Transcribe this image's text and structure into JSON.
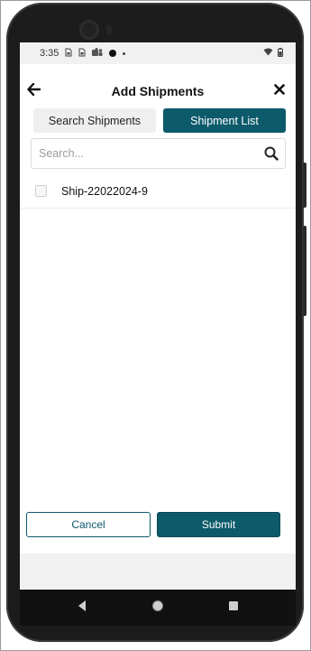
{
  "status_bar": {
    "time": "3:35",
    "icons_left": [
      "sim-icon",
      "sim-icon",
      "teams-icon",
      "notification-dot",
      "more-dot"
    ],
    "icons_right": [
      "wifi-icon",
      "battery-icon"
    ]
  },
  "header": {
    "title": "Add Shipments",
    "back_icon": "back-arrow-icon",
    "close_icon": "close-icon"
  },
  "tabs": [
    {
      "label": "Search Shipments",
      "active": false
    },
    {
      "label": "Shipment List",
      "active": true
    }
  ],
  "search": {
    "placeholder": "Search...",
    "value": ""
  },
  "shipments": [
    {
      "label": "Ship-22022024-9",
      "checked": false
    }
  ],
  "footer": {
    "cancel_label": "Cancel",
    "submit_label": "Submit"
  },
  "colors": {
    "accent": "#0d5a6b",
    "tab_inactive": "#efefef"
  },
  "nav": {
    "back": "nav-back-icon",
    "home": "nav-home-icon",
    "recents": "nav-recents-icon"
  }
}
